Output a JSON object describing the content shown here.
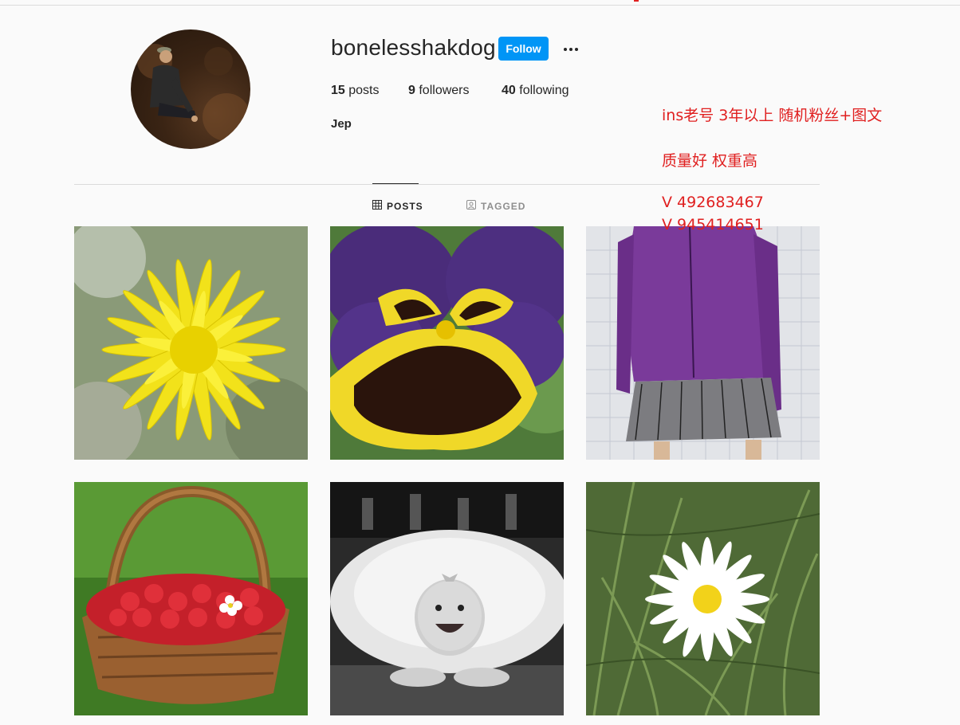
{
  "profile": {
    "username": "bonelesshakdog",
    "follow_label": "Follow",
    "more_icon": "more-options-icon",
    "stats": {
      "posts_count": "15",
      "posts_label": "posts",
      "followers_count": "9",
      "followers_label": "followers",
      "following_count": "40",
      "following_label": "following"
    },
    "bio_name": "Jep"
  },
  "overlay_ad": {
    "line1": "ins老号 3年以上 随机粉丝+图文",
    "line2": "质量好  权重高",
    "line3": "V 492683467",
    "line4": "V 945414651"
  },
  "tabs": [
    {
      "label": "POSTS",
      "icon": "grid-icon",
      "active": true
    },
    {
      "label": "TAGGED",
      "icon": "tagged-icon",
      "active": false
    }
  ],
  "posts": [
    {
      "subject": "yellow dandelion flower"
    },
    {
      "subject": "purple and yellow pansy"
    },
    {
      "subject": "sketch of purple jacket and skirt"
    },
    {
      "subject": "basket of strawberries"
    },
    {
      "subject": "baby in white tutu"
    },
    {
      "subject": "white daisy in grass"
    }
  ],
  "colors": {
    "follow_button": "#0095f6",
    "ad_text": "#e02020",
    "page_background": "#fafafa"
  }
}
